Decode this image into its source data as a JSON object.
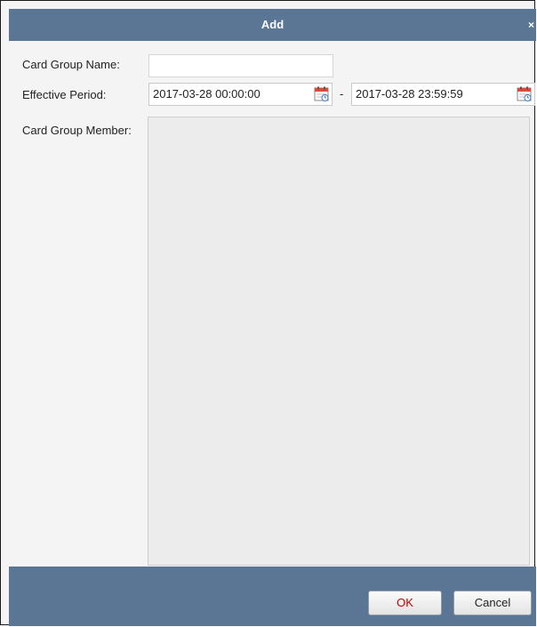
{
  "dialog": {
    "title": "Add",
    "close_label": "×"
  },
  "form": {
    "card_group_name_label": "Card Group Name:",
    "card_group_name_value": "",
    "effective_period_label": "Effective Period:",
    "start_datetime": "2017-03-28 00:00:00",
    "separator": "-",
    "end_datetime": "2017-03-28 23:59:59",
    "card_group_member_label": "Card Group Member:"
  },
  "buttons": {
    "ok_label": "OK",
    "cancel_label": "Cancel"
  },
  "icons": {
    "calendar": "calendar-icon",
    "close": "close-icon"
  },
  "colors": {
    "title_bar": "#5b7694",
    "ok_text": "#c00000"
  }
}
